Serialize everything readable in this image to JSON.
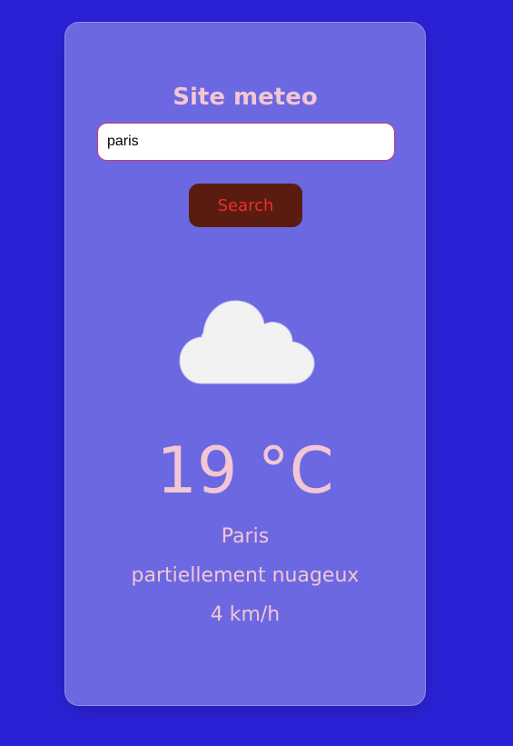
{
  "app": {
    "title": "Site meteo"
  },
  "search": {
    "value": "paris",
    "button_label": "Search"
  },
  "weather": {
    "icon": "cloud-icon",
    "temperature": "19 °C",
    "city": "Paris",
    "description": "partiellement nuageux",
    "wind": "4 km/h"
  },
  "colors": {
    "background": "#2b22d8",
    "card": "#6b68e2",
    "text": "#f3c6d4",
    "button_bg": "#5a1c10",
    "button_text": "#f02d2d",
    "input_border": "#d23a6a",
    "cloud": "#f2f2f2"
  }
}
